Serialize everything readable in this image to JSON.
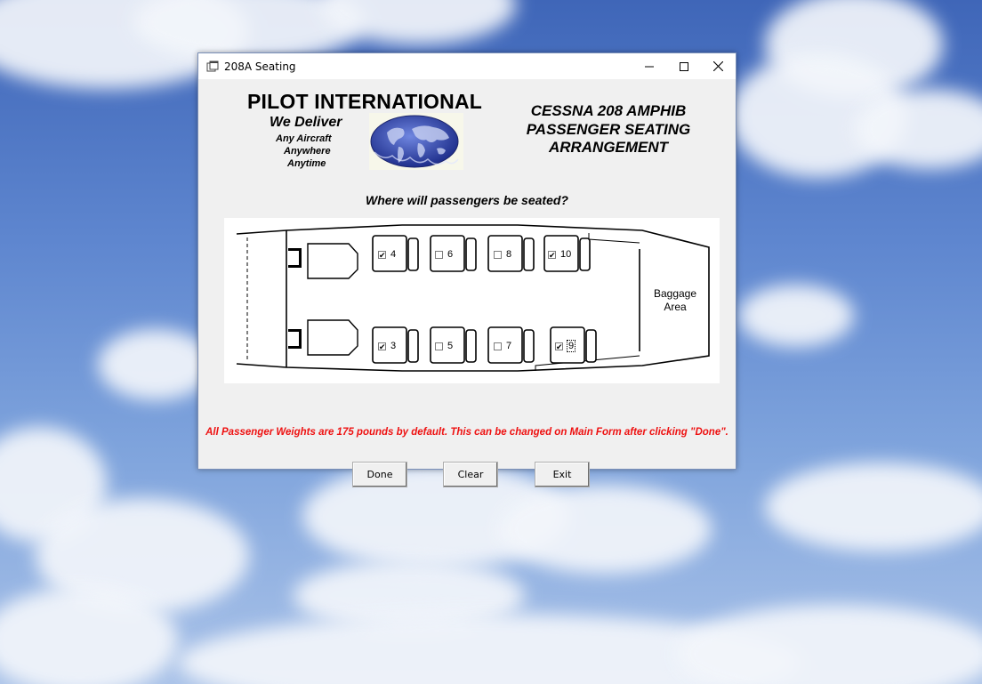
{
  "window": {
    "title": "208A Seating"
  },
  "header": {
    "company": "PILOT INTERNATIONAL",
    "slogan": "We Deliver",
    "sub_lines": [
      "Any Aircraft",
      "Anywhere",
      "Anytime"
    ],
    "aircraft_title": [
      "CESSNA 208 AMPHIB",
      "PASSENGER SEATING",
      "ARRANGEMENT"
    ]
  },
  "question": "Where will passengers be seated?",
  "seats": {
    "top": [
      {
        "label": "4",
        "checked": true
      },
      {
        "label": "6",
        "checked": false
      },
      {
        "label": "8",
        "checked": false
      },
      {
        "label": "10",
        "checked": true
      }
    ],
    "bottom": [
      {
        "label": "3",
        "checked": true
      },
      {
        "label": "5",
        "checked": false
      },
      {
        "label": "7",
        "checked": false
      },
      {
        "label": "9",
        "checked": true
      }
    ]
  },
  "baggage_area": "Baggage Area",
  "notice": "All Passenger Weights are 175 pounds by default.  This can be changed on Main Form after clicking \"Done\".",
  "buttons": {
    "done": "Done",
    "clear": "Clear",
    "exit": "Exit"
  },
  "colors": {
    "notice": "#ee1111",
    "globe": "#2a3d9e"
  },
  "icons": {
    "app": "app-window-icon",
    "minimize": "minimize-icon",
    "maximize": "maximize-icon",
    "close": "close-icon",
    "logo": "globe-logo-icon"
  }
}
